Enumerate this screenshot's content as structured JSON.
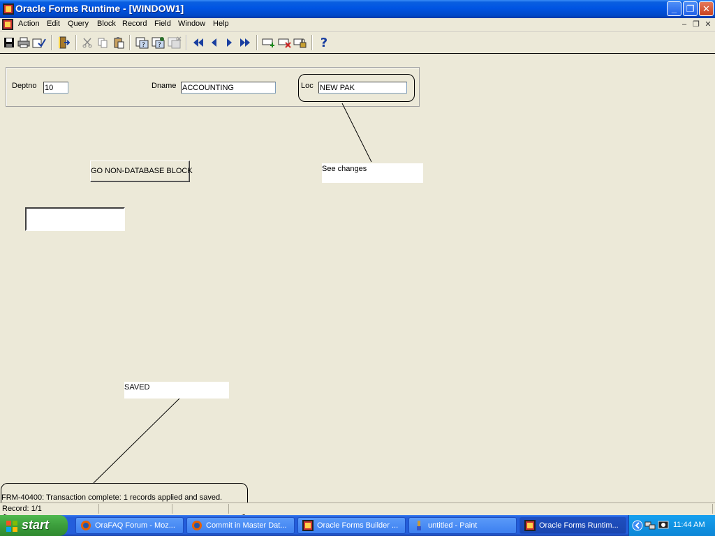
{
  "window": {
    "title": "Oracle Forms Runtime - [WINDOW1]",
    "minimize_glyph": "_",
    "maximize_glyph": "❐",
    "close_glyph": "✕"
  },
  "menu": {
    "items": [
      "Action",
      "Edit",
      "Query",
      "Block",
      "Record",
      "Field",
      "Window",
      "Help"
    ],
    "mdi_minimize": "–",
    "mdi_restore": "❐",
    "mdi_close": "✕"
  },
  "toolbar": {
    "icons": [
      "save-icon",
      "print-icon",
      "clear-icon",
      "exit-icon",
      "cut-icon",
      "copy-icon",
      "paste-icon",
      "enter-query-icon",
      "execute-query-icon",
      "cancel-query-icon",
      "first-record-icon",
      "previous-record-icon",
      "next-record-icon",
      "last-record-icon",
      "insert-record-icon",
      "remove-record-icon",
      "lock-record-icon",
      "help-icon"
    ],
    "help_glyph": "?"
  },
  "form": {
    "deptno_label": "Deptno",
    "deptno_value": "10",
    "dname_label": "Dname",
    "dname_value": "ACCOUNTING",
    "loc_label": "Loc",
    "loc_value": "NEW PAK",
    "button_label": "GO NON-DATABASE  BLOCK",
    "empty_field_value": ""
  },
  "annotations": {
    "see_changes": "See changes",
    "saved": "SAVED"
  },
  "status": {
    "message": "FRM-40400: Transaction complete: 1 records applied and saved.",
    "record": "Record: 1/1"
  },
  "taskbar": {
    "start_label": "start",
    "tasks": [
      "OraFAQ Forum - Moz...",
      "Commit in Master Dat...",
      "Oracle Forms Builder ...",
      "untitled - Paint",
      "Oracle Forms Runtim..."
    ],
    "clock": "11:44 AM"
  },
  "colors": {
    "titlebar": "#0054e3",
    "window_bg": "#ece9d8",
    "taskbar": "#245edb",
    "start_button": "#3c9e3c"
  }
}
